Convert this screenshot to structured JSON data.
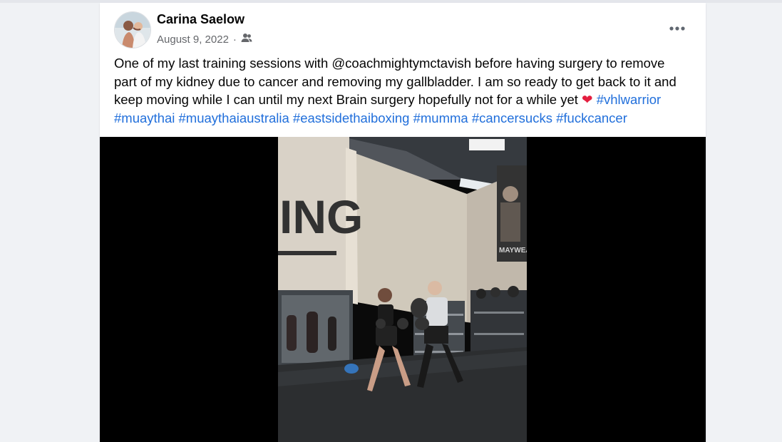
{
  "post": {
    "author": "Carina Saelow",
    "date": "August 9, 2022",
    "separator": "·",
    "audience_icon": "friends-icon",
    "more_icon": "more-horizontal-icon",
    "text_lines": {
      "line1": "One of my last training sessions with @coachmightymctavish before having surgery to remove",
      "line2": "part of my kidney due to cancer and removing my gallbladder. I am so ready to get back to it and",
      "line3_plain": "keep moving while I can until my next Brain surgery hopefully not for a while yet",
      "heart_emoji": "❤",
      "tag_vhlwarrior": "#vhlwarrior"
    },
    "hashtags": [
      "#muaythai",
      "#muaythaiaustralia",
      "#eastsidethaiboxing",
      "#mumma",
      "#cancersucks",
      "#fuckcancer"
    ],
    "video": {
      "wall_text": "ING",
      "poster_text": "MAYWEA"
    }
  },
  "colors": {
    "link": "#216fdb",
    "text": "#050505",
    "muted": "#65676b",
    "page_bg": "#f0f2f5",
    "heart": "#e41e3f"
  }
}
